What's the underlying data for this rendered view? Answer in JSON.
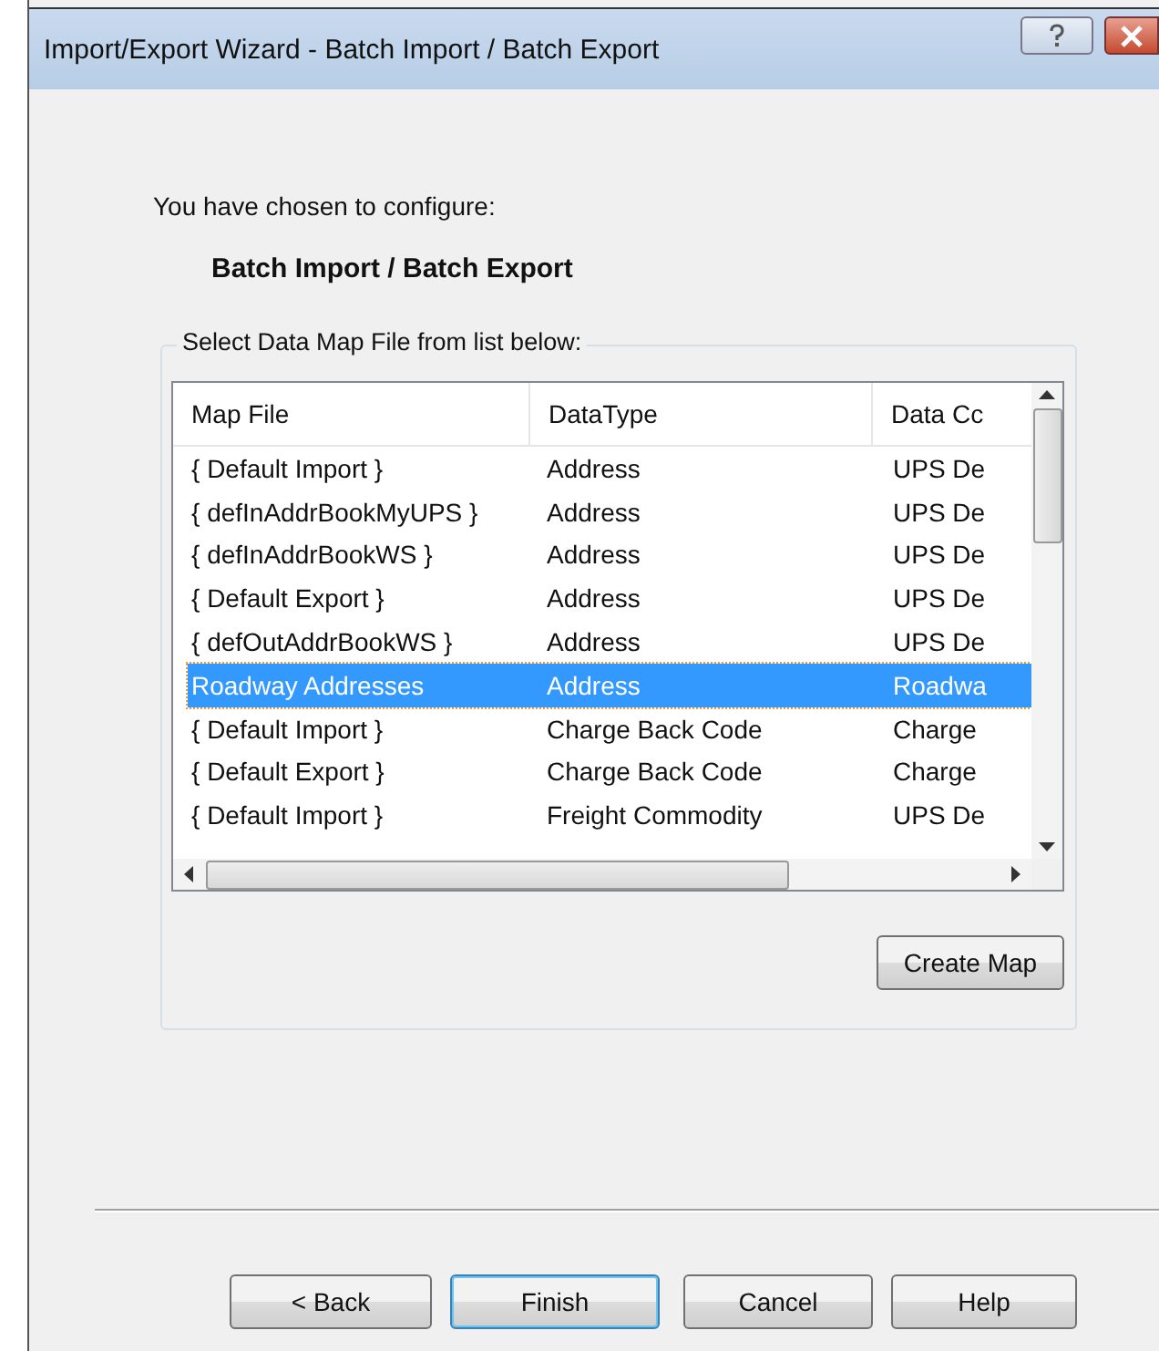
{
  "window": {
    "title": "Import/Export Wizard - Batch Import / Batch Export"
  },
  "intro": "You have chosen to configure:",
  "configuration": "Batch Import / Batch Export",
  "group": {
    "label": "Select Data Map File from list below:"
  },
  "table": {
    "columns": [
      "Map File",
      "DataType",
      "Data Cc"
    ],
    "rows": [
      {
        "cells": [
          "{ Default Import }",
          "Address",
          "UPS De"
        ],
        "selected": false
      },
      {
        "cells": [
          "{ defInAddrBookMyUPS }",
          "Address",
          "UPS De"
        ],
        "selected": false
      },
      {
        "cells": [
          "{ defInAddrBookWS }",
          "Address",
          "UPS De"
        ],
        "selected": false
      },
      {
        "cells": [
          "{ Default Export }",
          "Address",
          "UPS De"
        ],
        "selected": false
      },
      {
        "cells": [
          "{ defOutAddrBookWS }",
          "Address",
          "UPS De"
        ],
        "selected": false
      },
      {
        "cells": [
          "Roadway Addresses",
          "Address",
          "Roadwa"
        ],
        "selected": true
      },
      {
        "cells": [
          "{ Default Import }",
          "Charge Back Code",
          "Charge"
        ],
        "selected": false
      },
      {
        "cells": [
          "{ Default Export }",
          "Charge Back Code",
          "Charge"
        ],
        "selected": false
      },
      {
        "cells": [
          "{ Default Import }",
          "Freight Commodity",
          "UPS De"
        ],
        "selected": false
      }
    ]
  },
  "create_button": "Create Map",
  "buttons": [
    {
      "label": "< Back",
      "default": false
    },
    {
      "label": "Finish",
      "default": true
    },
    {
      "label": "Cancel",
      "default": false
    },
    {
      "label": "Help",
      "default": false
    }
  ]
}
